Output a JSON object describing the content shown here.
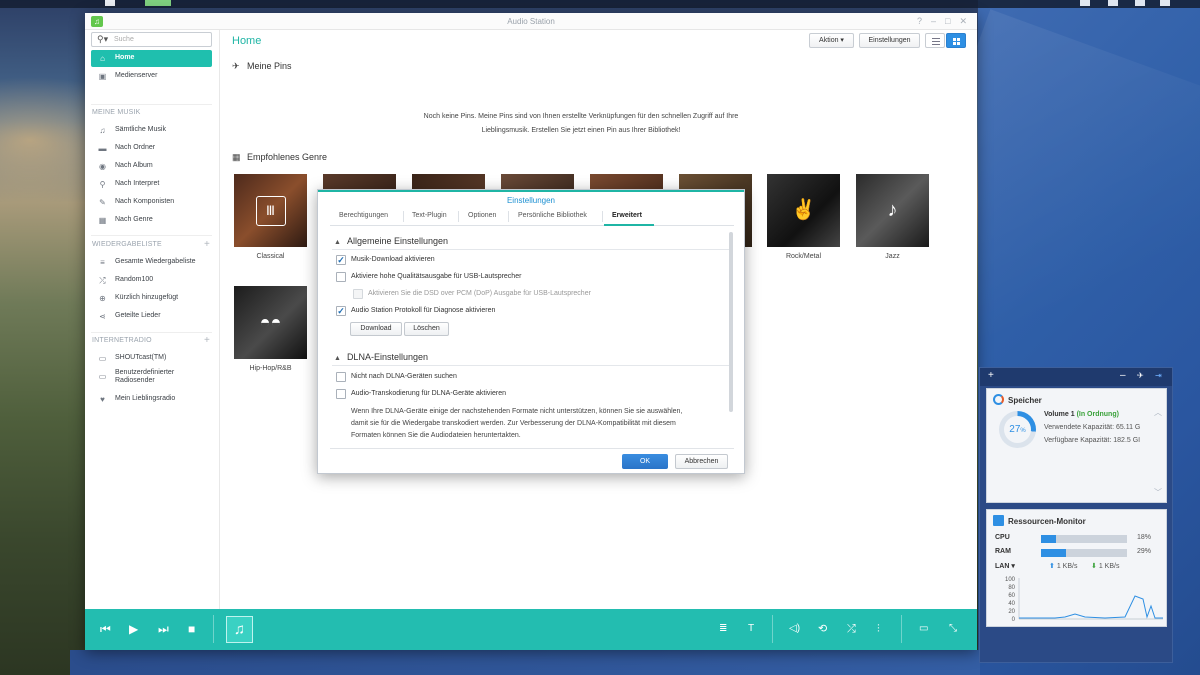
{
  "window": {
    "title": "Audio Station"
  },
  "sidebar": {
    "search_placeholder": "Suche",
    "top_items": [
      {
        "label": "Home",
        "icon": "home-icon",
        "active": true
      },
      {
        "label": "Medienserver",
        "icon": "server-icon"
      }
    ],
    "sections": [
      {
        "title": "MEINE MUSIK",
        "items": [
          {
            "label": "Sämtliche Musik",
            "icon": "music-note-icon"
          },
          {
            "label": "Nach Ordner",
            "icon": "folder-icon"
          },
          {
            "label": "Nach Album",
            "icon": "album-icon"
          },
          {
            "label": "Nach Interpret",
            "icon": "microphone-icon"
          },
          {
            "label": "Nach Komponisten",
            "icon": "pen-icon"
          },
          {
            "label": "Nach Genre",
            "icon": "grid-icon"
          }
        ]
      },
      {
        "title": "WIEDERGABELISTE",
        "items": [
          {
            "label": "Gesamte Wiedergabeliste",
            "icon": "playlist-icon"
          },
          {
            "label": "Random100",
            "icon": "shuffle-icon"
          },
          {
            "label": "Kürzlich hinzugefügt",
            "icon": "plus-circle-icon"
          },
          {
            "label": "Geteilte Lieder",
            "icon": "share-icon"
          }
        ]
      },
      {
        "title": "INTERNETRADIO",
        "items": [
          {
            "label": "SHOUTcast(TM)",
            "icon": "radio-icon"
          },
          {
            "label": "Benutzerdefinierter Radiosender",
            "icon": "radio-icon"
          },
          {
            "label": "Mein Lieblingsradio",
            "icon": "heart-icon"
          }
        ]
      }
    ]
  },
  "main": {
    "page_title": "Home",
    "action_label": "Aktion ▾",
    "settings_label": "Einstellungen",
    "pins_title": "Meine Pins",
    "pins_empty_line1": "Noch keine Pins. Meine Pins sind von Ihnen erstellte Verknüpfungen für den schnellen Zugriff auf Ihre",
    "pins_empty_line2": "Lieblingsmusik. Erstellen Sie jetzt einen Pin aus Ihrer Bibliothek!",
    "genre_title": "Empfohlenes Genre",
    "genres": [
      {
        "label": "Classical"
      },
      {
        "label": ""
      },
      {
        "label": ""
      },
      {
        "label": ""
      },
      {
        "label": ""
      },
      {
        "label": ""
      },
      {
        "label": "Rock/Metal"
      },
      {
        "label": "Jazz"
      },
      {
        "label": "Hip-Hop/R&B"
      }
    ]
  },
  "dialog": {
    "title": "Einstellungen",
    "tabs": [
      "Berechtigungen",
      "Text-Plugin",
      "Optionen",
      "Persönliche Bibliothek",
      "Erweitert"
    ],
    "active_tab": "Erweitert",
    "group1": "Allgemeine Einstellungen",
    "opt_download": "Musik-Download aktivieren",
    "opt_hq": "Aktiviere hohe Qualitätsausgabe für USB-Lautsprecher",
    "opt_dsd": "Aktivieren Sie die DSD over PCM (DoP) Ausgabe für USB-Lautsprecher",
    "opt_log": "Audio Station Protokoll für Diagnose aktivieren",
    "btn_download": "Download",
    "btn_delete": "Löschen",
    "group2": "DLNA-Einstellungen",
    "opt_nodlna": "Nicht nach DLNA-Geräten suchen",
    "opt_transcode": "Audio-Transkodierung für DLNA-Geräte aktivieren",
    "desc1": "Wenn Ihre DLNA-Geräte einige der nachstehenden Formate nicht unterstützen, können Sie sie auswählen,",
    "desc2": "damit sie für die Wiedergabe transkodiert werden. Zur Verbesserung der DLNA-Kompatibilität mit diesem",
    "desc3": "Formaten können Sie die Audiodateien heruntertakten.",
    "ok": "OK",
    "cancel": "Abbrechen",
    "checked": {
      "download": true,
      "hq": false,
      "dsd": false,
      "log": true,
      "nodlna": false,
      "transcode": false
    }
  },
  "widgets": {
    "storage": {
      "title": "Speicher",
      "percent": "27",
      "percent_unit": "%",
      "volume": "Volume 1",
      "status": "(In Ordnung)",
      "used": "Verwendete Kapazität: 65.11 G",
      "free": "Verfügbare Kapazität: 182.5 GI"
    },
    "monitor": {
      "title": "Ressourcen-Monitor",
      "cpu_label": "CPU",
      "cpu_val": "18%",
      "cpu_pct": 18,
      "ram_label": "RAM",
      "ram_val": "29%",
      "ram_pct": 29,
      "lan_label": "LAN ▾",
      "up": "1 KB/s",
      "down": "1 KB/s",
      "y_ticks": [
        "100",
        "80",
        "60",
        "40",
        "20",
        "0"
      ]
    }
  },
  "colors": {
    "accent": "#1fbfae",
    "primary_button": "#2e8fe3",
    "player": "#23bdb0"
  }
}
